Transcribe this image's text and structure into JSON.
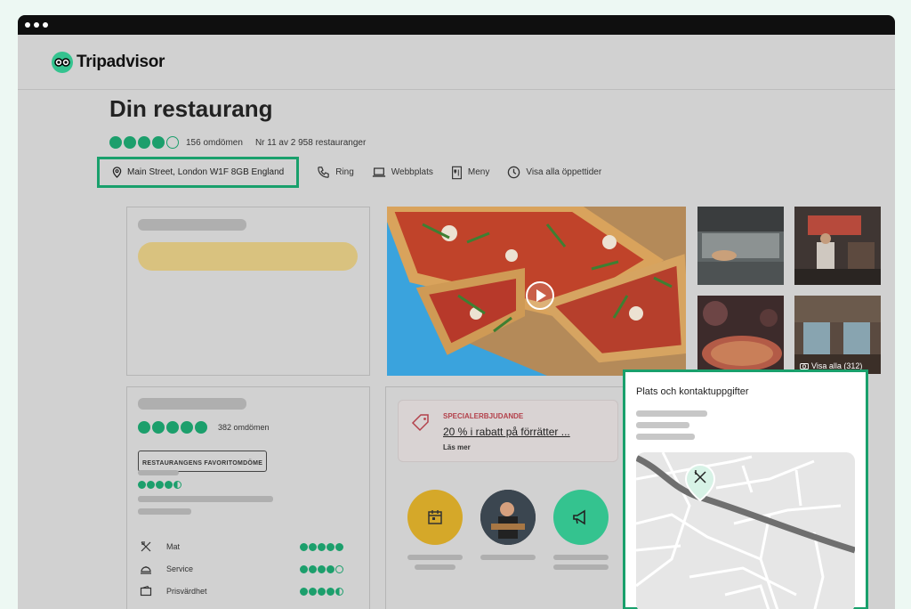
{
  "brand": {
    "name": "Tripadvisor"
  },
  "restaurant": {
    "name": "Din restaurang",
    "reviews": "156 omdömen",
    "rank": "Nr 11 av 2 958 restauranger",
    "rating_bubbles": 4,
    "address": "Main Street, London W1F 8GB England"
  },
  "actions": {
    "call": "Ring",
    "website": "Webbplats",
    "menu": "Meny",
    "hours": "Visa alla öppettider"
  },
  "gallery": {
    "see_all": "Visa alla (312)"
  },
  "ratings_card": {
    "reviews": "382 omdömen",
    "badge": "RESTAURANGENS FAVORITOMDÖME",
    "overall_bubbles": 5,
    "review_bubbles": 4.5,
    "criteria": [
      {
        "label": "Mat",
        "value": 5
      },
      {
        "label": "Service",
        "value": 4
      },
      {
        "label": "Prisvärdhet",
        "value": 4.5
      }
    ]
  },
  "offer": {
    "kicker": "SPECIALERBJUDANDE",
    "title": "20 % i rabatt på förrätter ...",
    "link": "Läs mer"
  },
  "contact": {
    "title": "Plats och kontaktuppgifter"
  },
  "colors": {
    "accent": "#19a06c",
    "bubble": "#1c9f6c",
    "offer_red": "#b3414b",
    "yellow_cta": "#d9c27f"
  }
}
